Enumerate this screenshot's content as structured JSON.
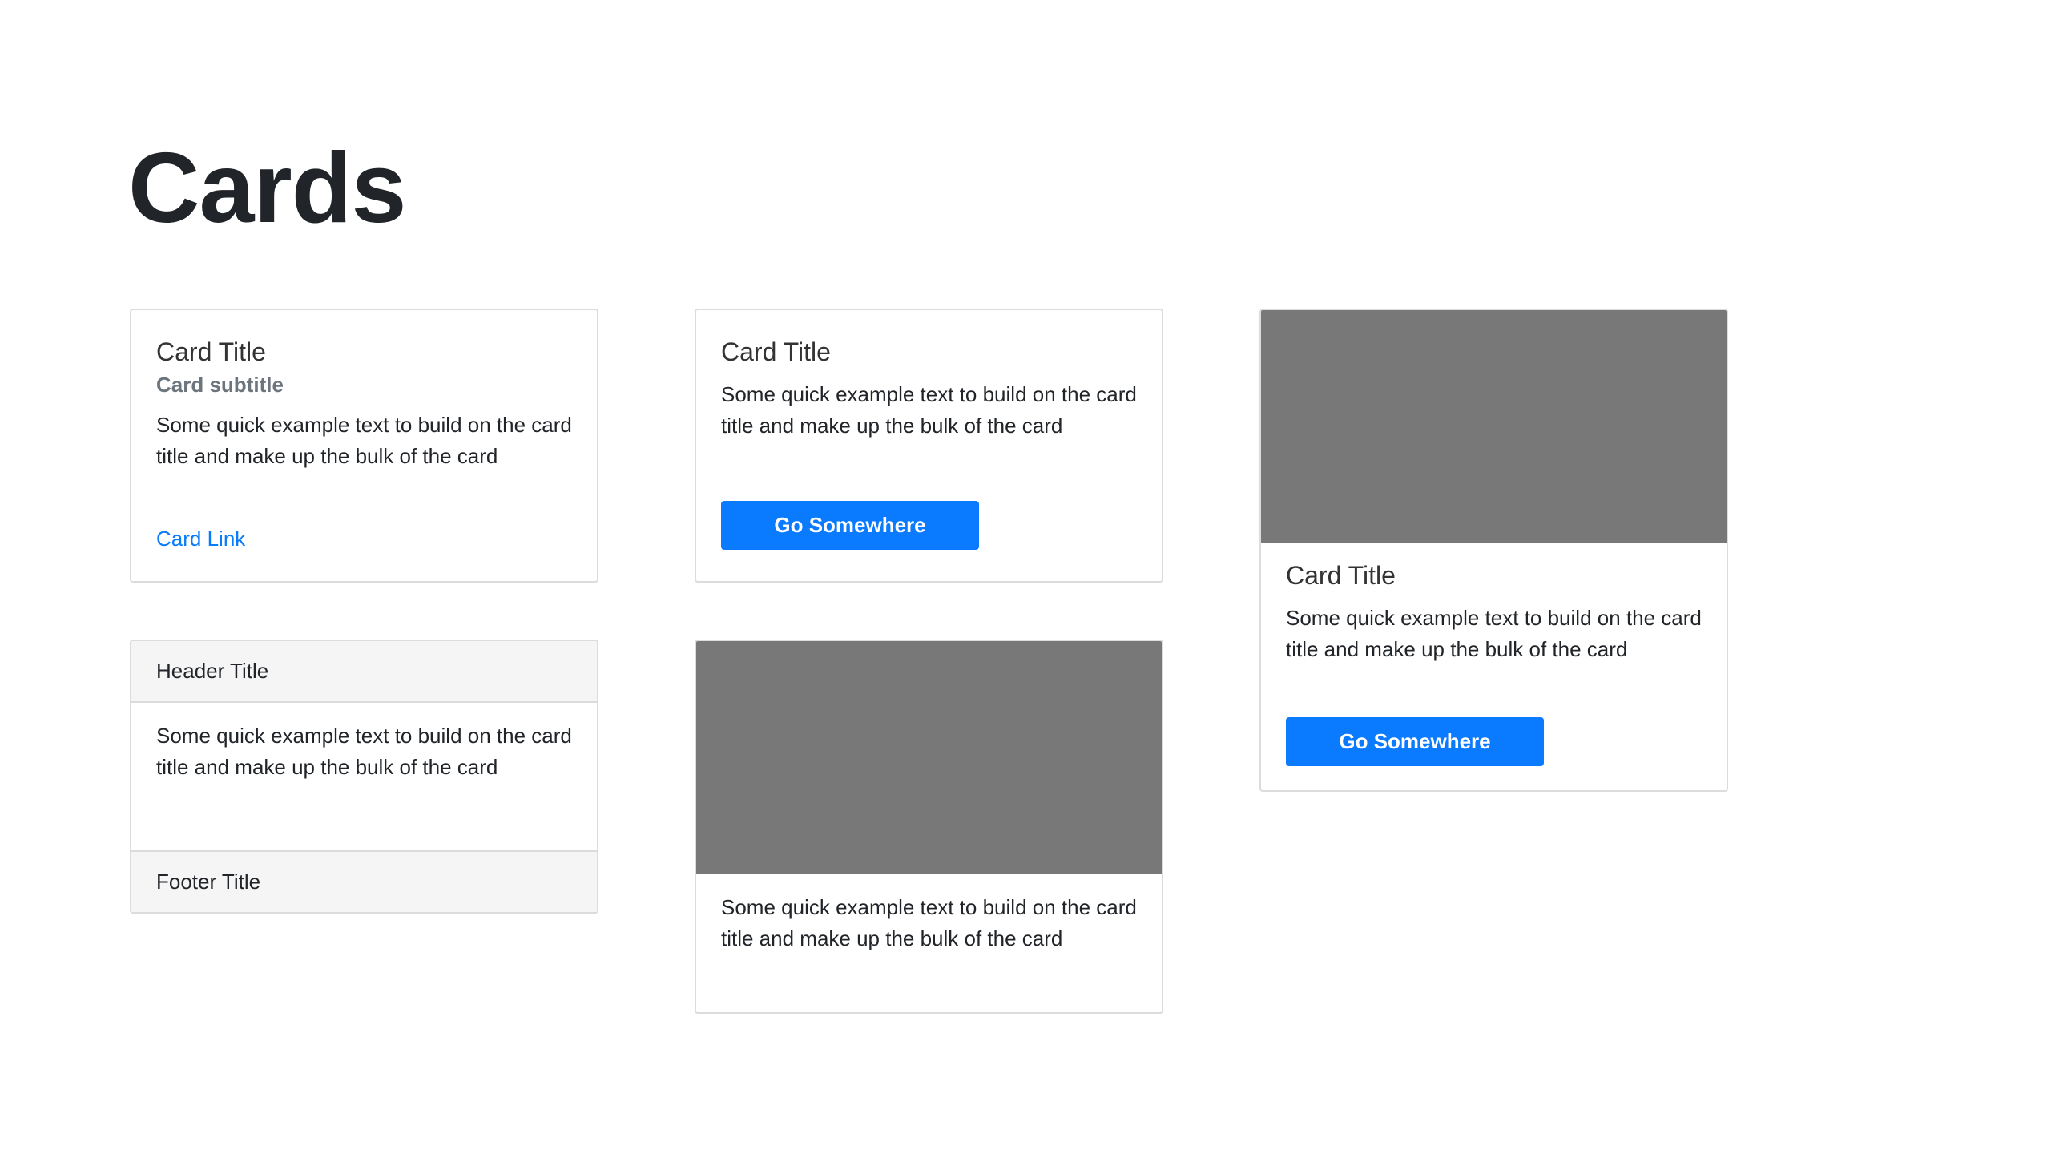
{
  "page": {
    "title": "Cards"
  },
  "cards": {
    "subtitle_card": {
      "title": "Card Title",
      "subtitle": "Card subtitle",
      "text": "Some quick example text to build on the card title and make up the bulk of the card",
      "link": "Card Link"
    },
    "button_card": {
      "title": "Card Title",
      "text": "Some quick example text to build on the card title and make up the bulk of the card",
      "button": "Go Somewhere"
    },
    "image_button_card": {
      "title": "Card Title",
      "text": "Some quick example text to build on the card title and make up the bulk of the card",
      "button": "Go Somewhere"
    },
    "header_footer_card": {
      "header": "Header Title",
      "text": "Some quick example text to build on the card title and make up the bulk of the card",
      "footer": "Footer Title"
    },
    "image_text_card": {
      "text": "Some quick example text to build on the card title and make up the bulk of the card"
    }
  },
  "colors": {
    "primary": "#0a7bff",
    "image_placeholder": "#787878",
    "header_footer_bg": "#f5f5f5",
    "border": "#dcdcdc"
  }
}
